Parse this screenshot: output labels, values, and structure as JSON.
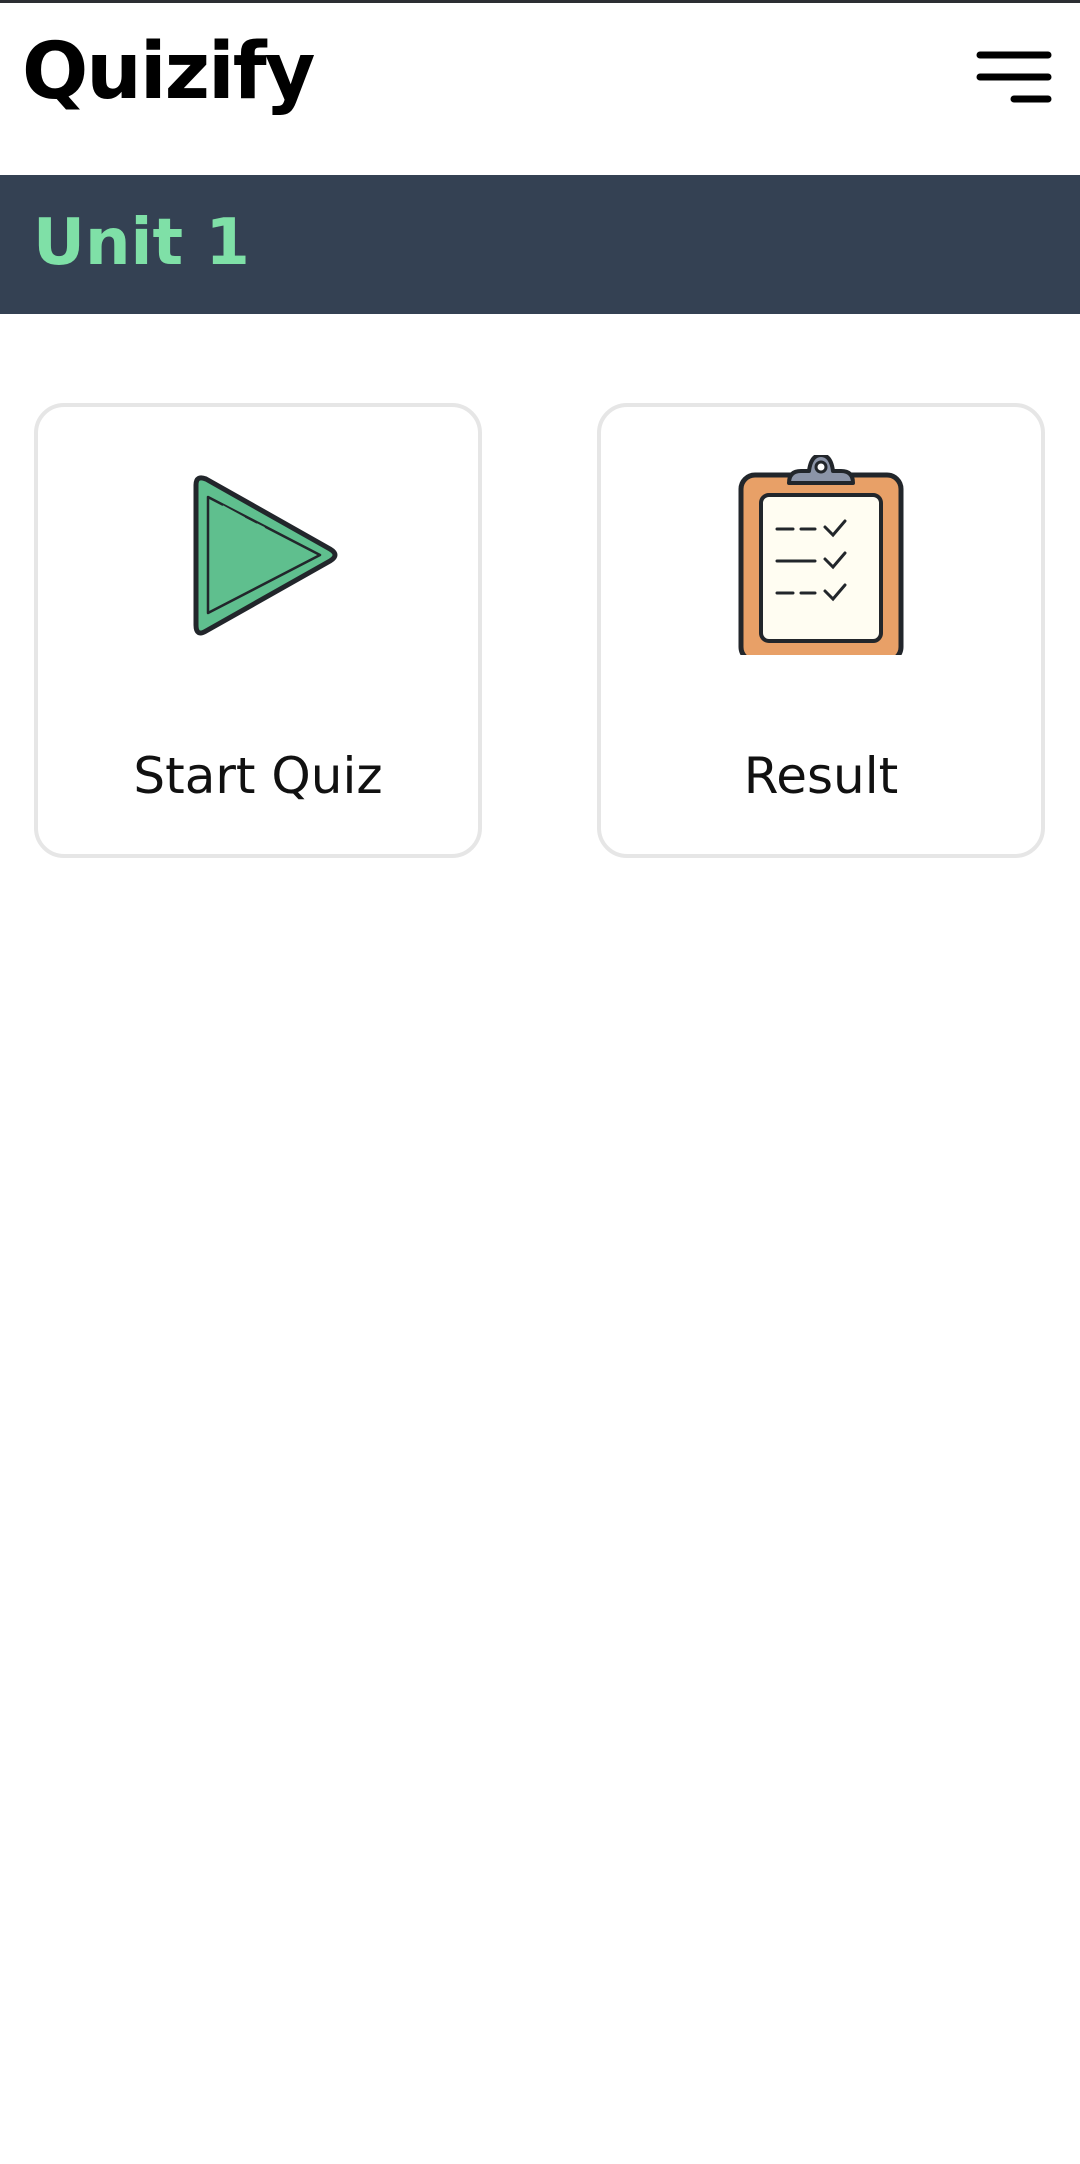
{
  "app": {
    "title": "Quizify",
    "menu_icon": "hamburger-menu-icon"
  },
  "banner": {
    "title": "Unit 1",
    "background": "#344153",
    "title_color": "#7fe0a7"
  },
  "cards": [
    {
      "label": "Start Quiz",
      "icon": "play-icon",
      "icon_color": "#5fbf8e"
    },
    {
      "label": "Result",
      "icon": "clipboard-checklist-icon",
      "icon_color": "#e8a067"
    }
  ]
}
